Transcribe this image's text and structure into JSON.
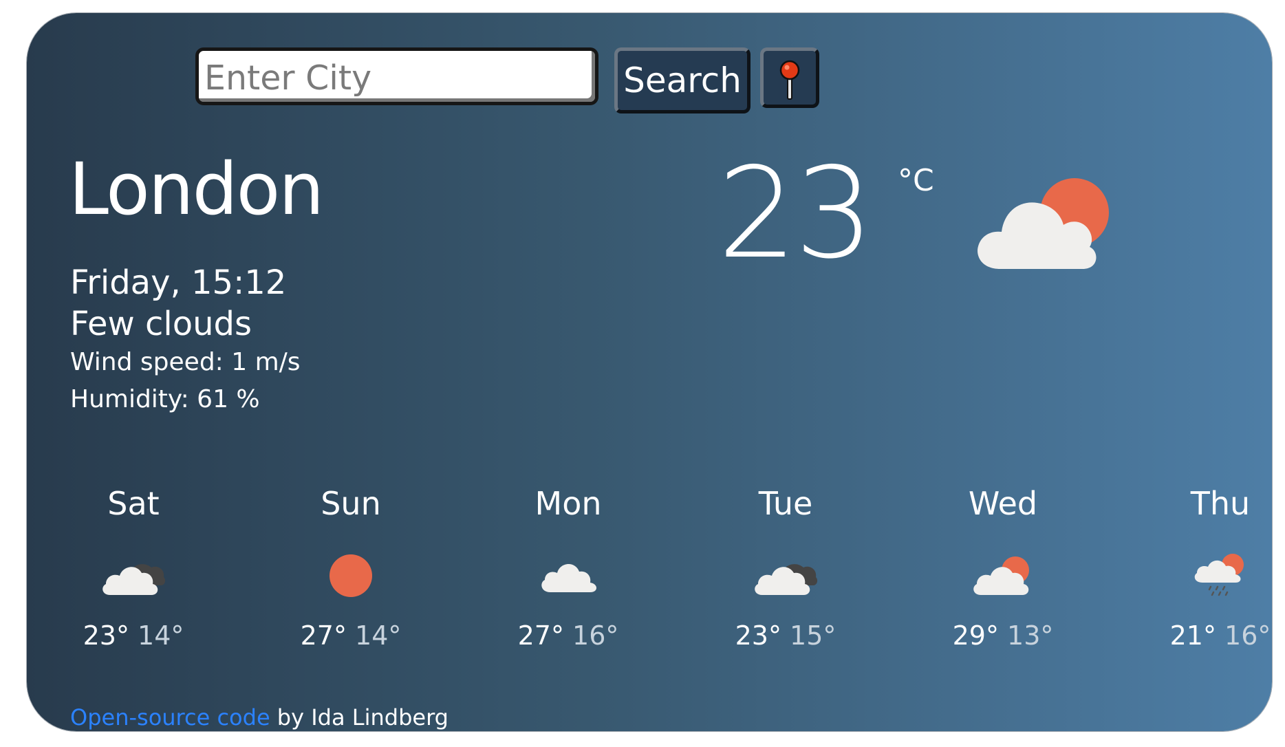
{
  "search": {
    "placeholder": "Enter City",
    "button_label": "Search",
    "location_icon": "map-pin-icon"
  },
  "current": {
    "city": "London",
    "datetime": "Friday, 15:12",
    "description": "Few clouds",
    "wind": "Wind speed: 1 m/s",
    "humidity": "Humidity: 61 %",
    "temperature": "23",
    "unit": "°C",
    "icon": "few-clouds-icon"
  },
  "forecast": [
    {
      "day": "Sat",
      "max": "23°",
      "min": "14°",
      "icon": "broken-clouds-icon"
    },
    {
      "day": "Sun",
      "max": "27°",
      "min": "14°",
      "icon": "clear-sky-icon"
    },
    {
      "day": "Mon",
      "max": "27°",
      "min": "16°",
      "icon": "clouds-icon"
    },
    {
      "day": "Tue",
      "max": "23°",
      "min": "15°",
      "icon": "broken-clouds-icon"
    },
    {
      "day": "Wed",
      "max": "29°",
      "min": "13°",
      "icon": "few-clouds-icon"
    },
    {
      "day": "Thu",
      "max": "21°",
      "min": "16°",
      "icon": "rain-icon"
    }
  ],
  "footer": {
    "link_text": "Open-source code",
    "author_text": " by Ida Lindberg"
  },
  "colors": {
    "sun": "#e8694a",
    "cloud": "#f0efed",
    "dark_cloud": "#444444",
    "link": "#2b82ff",
    "pin_red": "#e33a16"
  }
}
